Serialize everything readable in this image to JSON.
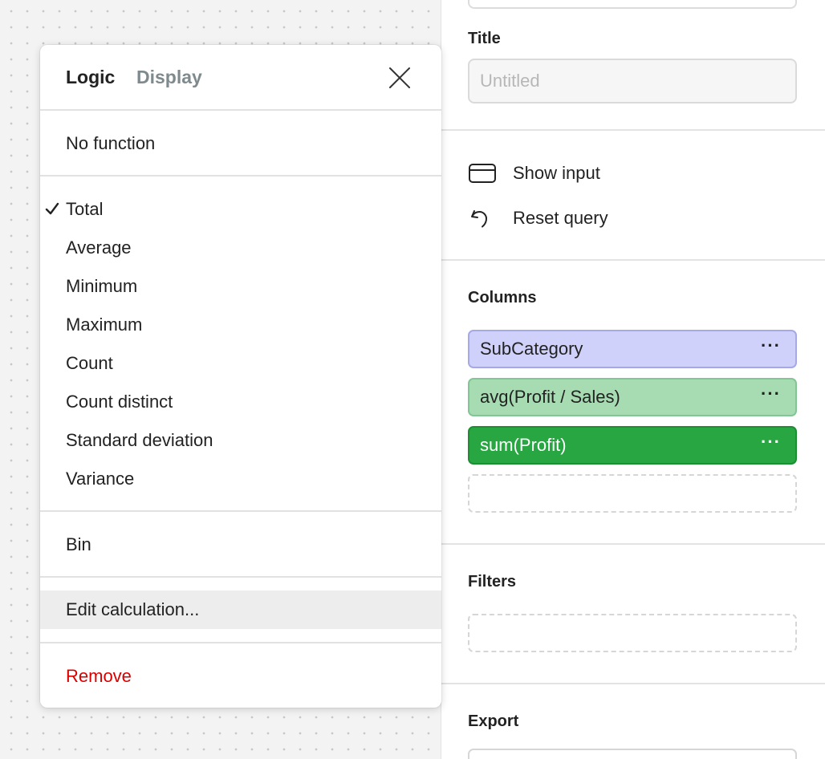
{
  "panel": {
    "title_label": "Title",
    "title_placeholder": "Untitled",
    "actions": [
      {
        "label": "Show input",
        "icon": "card-icon"
      },
      {
        "label": "Reset query",
        "icon": "undo-icon"
      }
    ],
    "columns_label": "Columns",
    "columns": [
      {
        "label": "SubCategory",
        "more": "···",
        "color": "#cfd1fa"
      },
      {
        "label": "avg(Profit / Sales)",
        "more": "···",
        "color": "#a7dcb3"
      },
      {
        "label": "sum(Profit)",
        "more": "···",
        "color": "#27a641"
      }
    ],
    "filters_label": "Filters",
    "export_label": "Export"
  },
  "menu": {
    "tabs": [
      {
        "label": "Logic",
        "active": true
      },
      {
        "label": "Display",
        "active": false
      }
    ],
    "no_function": "No function",
    "functions": [
      {
        "label": "Total",
        "checked": true
      },
      {
        "label": "Average",
        "checked": false
      },
      {
        "label": "Minimum",
        "checked": false
      },
      {
        "label": "Maximum",
        "checked": false
      },
      {
        "label": "Count",
        "checked": false
      },
      {
        "label": "Count distinct",
        "checked": false
      },
      {
        "label": "Standard deviation",
        "checked": false
      },
      {
        "label": "Variance",
        "checked": false
      }
    ],
    "bin": "Bin",
    "edit_calculation": "Edit calculation...",
    "remove": "Remove",
    "remove_color": "#d90000"
  }
}
